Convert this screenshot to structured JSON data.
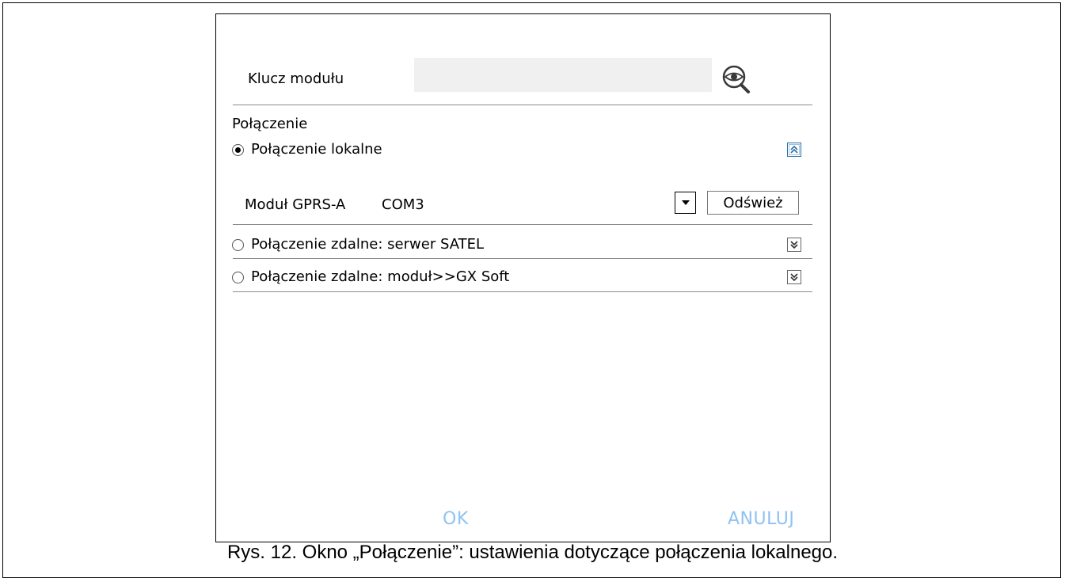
{
  "dialog": {
    "key_label": "Klucz modułu",
    "key_value": "",
    "connection_label": "Połączenie",
    "local": {
      "label": "Połączenie lokalne",
      "module_label": "Moduł GPRS-A",
      "port_value": "COM3",
      "refresh_label": "Odśwież"
    },
    "remote_satel": {
      "label": "Połączenie zdalne: serwer SATEL"
    },
    "remote_module": {
      "label": "Połączenie zdalne: moduł>>GX Soft"
    },
    "ok_label": "OK",
    "cancel_label": "ANULUJ"
  },
  "caption": "Rys. 12. Okno „Połączenie”: ustawienia dotyczące połączenia lokalnego.",
  "colors": {
    "footer_button": "#8fc2f2",
    "input_bg": "#f0f0f0",
    "active_outline": "#2b6ea8"
  },
  "icons": {
    "show_key": "eye-magnifier-icon",
    "collapse": "double-chevron-up-icon",
    "expand": "double-chevron-down-icon",
    "dropdown": "triangle-down-icon"
  }
}
